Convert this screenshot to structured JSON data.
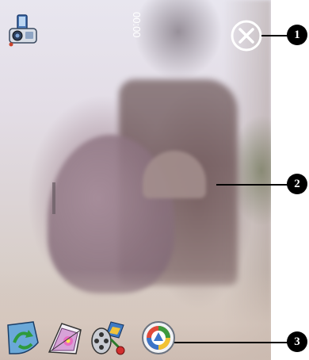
{
  "viewfinder": {
    "timer": "00:00"
  },
  "icons": {
    "mode": "camcorder-mode-icon",
    "close": "close-circle-icon",
    "toolbar": [
      "rotate-icon",
      "frame-effects-icon",
      "video-settings-icon",
      "capture-shutter-icon"
    ]
  },
  "callouts": [
    "1",
    "2",
    "3"
  ],
  "colors": {
    "overlay_white": "#ffffff",
    "callout_black": "#000000"
  }
}
